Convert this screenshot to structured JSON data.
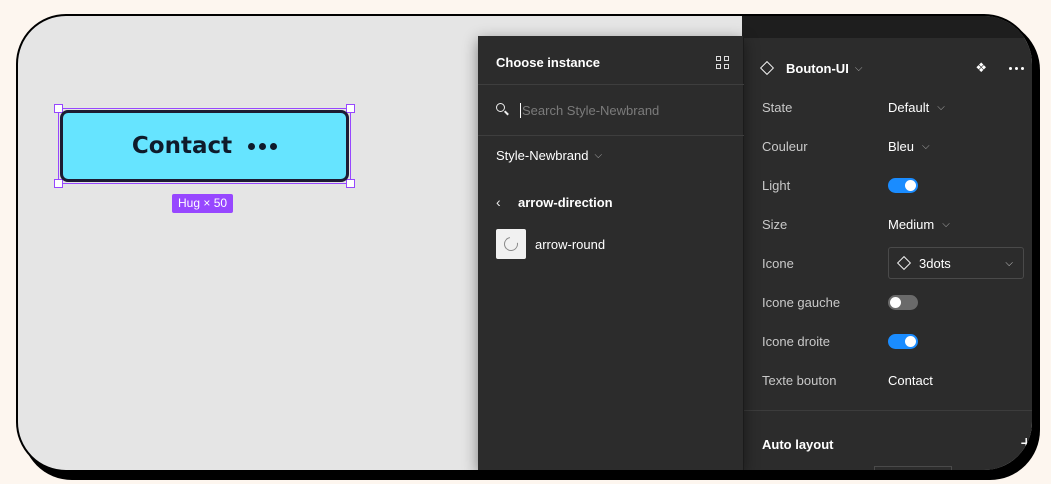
{
  "canvas": {
    "button_label": "Contact",
    "size_badge": "Hug × 50"
  },
  "chooser": {
    "title": "Choose instance",
    "search_placeholder": "Search Style-Newbrand",
    "library": "Style-Newbrand",
    "folder": "arrow-direction",
    "items": [
      {
        "label": "arrow-round"
      }
    ]
  },
  "properties": {
    "component_name": "Bouton-UI",
    "rows": [
      {
        "label": "State",
        "value": "Default"
      },
      {
        "label": "Couleur",
        "value": "Bleu"
      },
      {
        "label": "Light",
        "toggle": true
      },
      {
        "label": "Size",
        "value": "Medium"
      },
      {
        "label": "Icone",
        "value": "3dots"
      },
      {
        "label": "Icone gauche",
        "toggle": false
      },
      {
        "label": "Icone droite",
        "toggle": true
      },
      {
        "label": "Texte bouton",
        "value": "Contact"
      }
    ],
    "auto_layout": "Auto layout"
  },
  "colors": {
    "button_fill": "#66e4ff",
    "selection": "#9747ff",
    "toggle_on": "#1a8cff",
    "panel_bg": "#2c2c2c",
    "canvas_bg": "#e5e5e5"
  }
}
